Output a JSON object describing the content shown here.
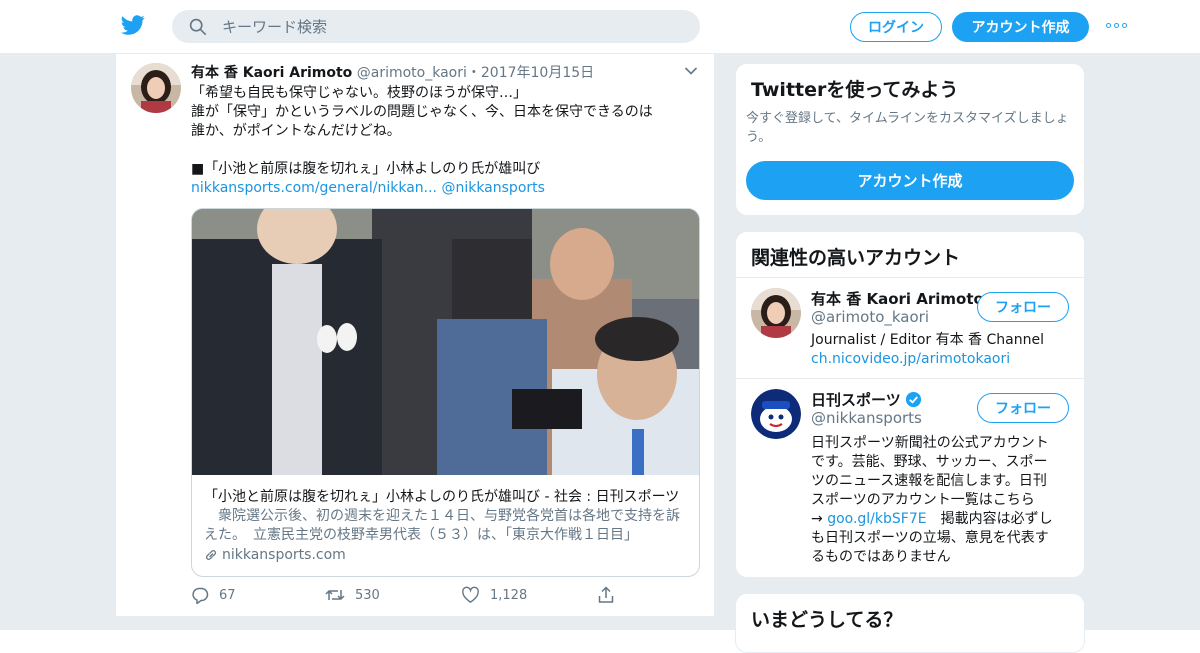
{
  "topbar": {
    "search_placeholder": "キーワード検索",
    "login_label": "ログイン",
    "signup_label": "アカウント作成",
    "brand_color": "#1da1f2"
  },
  "tweet": {
    "author_name": "有本 香 Kaori Arimoto",
    "author_handle": "@arimoto_kaori",
    "date": "・2017年10月15日",
    "lines": [
      "「希望も自民も保守じゃない。枝野のほうが保守…」",
      "誰が「保守」かというラベルの問題じゃなく、今、日本を保守できるのは",
      "誰か、がポイントなんだけどね。",
      "■「小池と前原は腹を切れぇ」小林よしのり氏が雄叫び"
    ],
    "link_text": "nikkansports.com/general/nikkan...",
    "mention": "@nikkansports",
    "card": {
      "title": "「小池と前原は腹を切れぇ」小林よしのり氏が雄叫び - 社会 : 日刊スポーツ",
      "description": "　衆院選公示後、初の週末を迎えた１４日、与野党各党首は各地で支持を訴えた。　立憲民主党の枝野幸男代表（５３）は、「東京大作戦１日目」",
      "domain": "nikkansports.com"
    },
    "actions": {
      "replies": "67",
      "retweets": "530",
      "likes": "1,128"
    }
  },
  "sidebar": {
    "signup_module": {
      "title": "Twitterを使ってみよう",
      "subtitle": "今すぐ登録して、タイムラインをカスタマイズしましょう。",
      "button": "アカウント作成"
    },
    "related": {
      "title": "関連性の高いアカウント",
      "follow_label": "フォロー",
      "accounts": [
        {
          "name": "有本 香 Kaori Arimoto",
          "handle": "@arimoto_kaori",
          "bio": "Journalist / Editor 有本 香 Channel",
          "bio_link": "ch.nicovideo.jp/arimotokaori"
        },
        {
          "name": "日刊スポーツ",
          "handle": "@nikkansports",
          "bio_lines": [
            "日刊スポーツ新聞社の公式アカウント",
            "です。芸能、野球、サッカー、スポー",
            "ツのニュース速報を配信します。日刊",
            "スポーツのアカウント一覧はこちら"
          ],
          "bio_link_prefix": "→ ",
          "bio_link": "goo.gl/kbSF7E",
          "bio_tail_lines": [
            "　掲載内容は必ずし",
            "も日刊スポーツの立場、意見を代表す",
            "るものではありません"
          ]
        }
      ]
    },
    "trends_title": "いまどうしてる？"
  }
}
